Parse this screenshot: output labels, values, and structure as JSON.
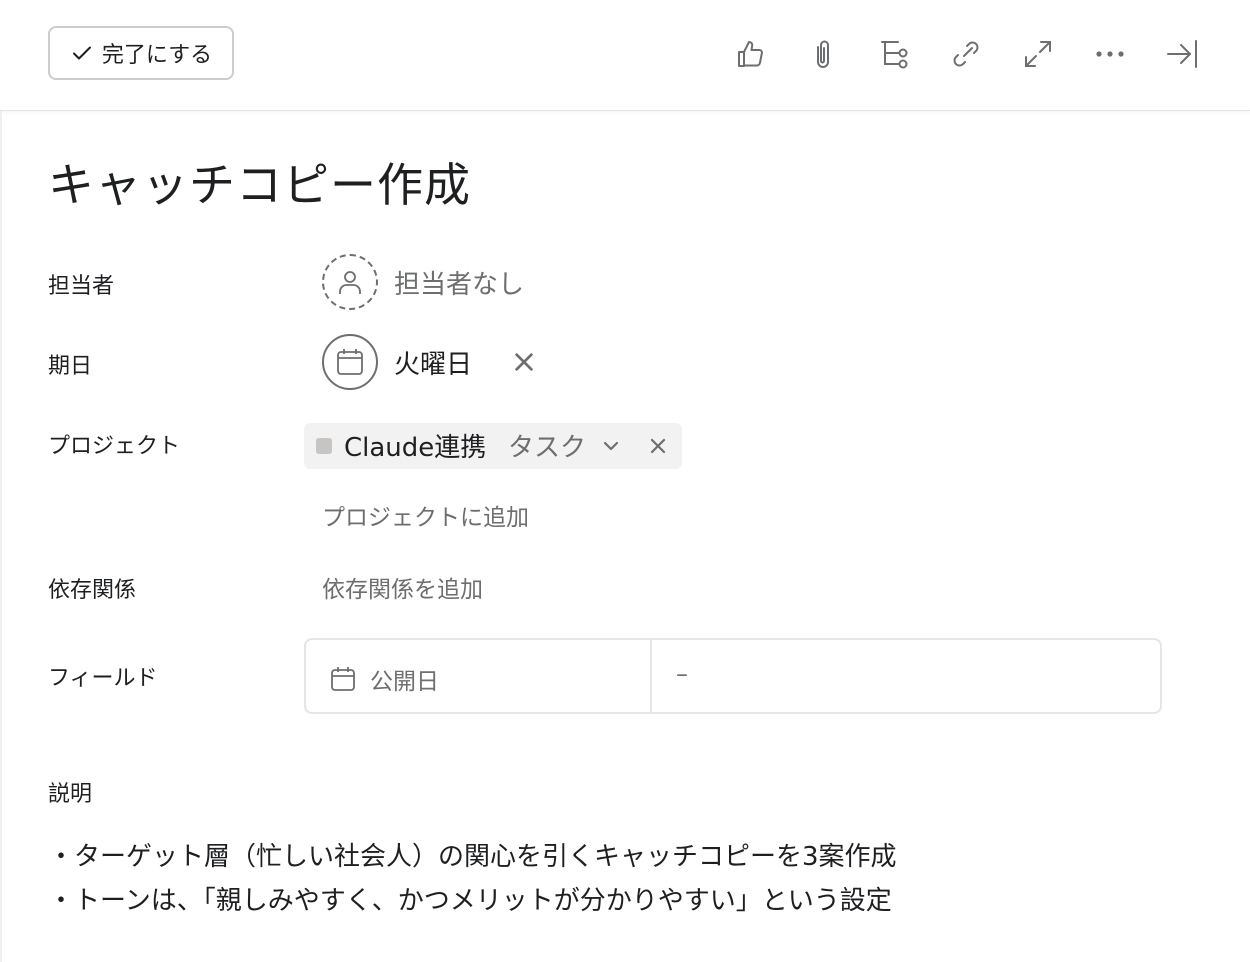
{
  "toolbar": {
    "complete_label": "完了にする",
    "icons": [
      "thumbs-up-icon",
      "paperclip-icon",
      "subtask-icon",
      "link-icon",
      "expand-icon",
      "more-icon",
      "close-pane-icon"
    ]
  },
  "task": {
    "title": "キャッチコピー作成"
  },
  "fields": {
    "assignee": {
      "label": "担当者",
      "value": "担当者なし"
    },
    "due_date": {
      "label": "期日",
      "value": "火曜日"
    },
    "projects": {
      "label": "プロジェクト",
      "project_name": "Claude連携",
      "section": "タスク",
      "add_label": "プロジェクトに追加"
    },
    "dependencies": {
      "label": "依存関係",
      "add_label": "依存関係を追加"
    },
    "custom_fields": {
      "label": "フィールド",
      "field_name": "公開日",
      "field_value": "–"
    }
  },
  "description": {
    "label": "説明",
    "lines": [
      "・ターゲット層（忙しい社会人）の関心を引くキャッチコピーを3案作成",
      "・トーンは、「親しみやすく、かつメリットが分かりやすい」という設定"
    ]
  },
  "colors": {
    "text": "#1e1f21",
    "muted": "#6d6e6f",
    "border": "#cfcbcb",
    "chip_bg": "#f2f2f2",
    "chip_dot": "#c7c4c4"
  }
}
